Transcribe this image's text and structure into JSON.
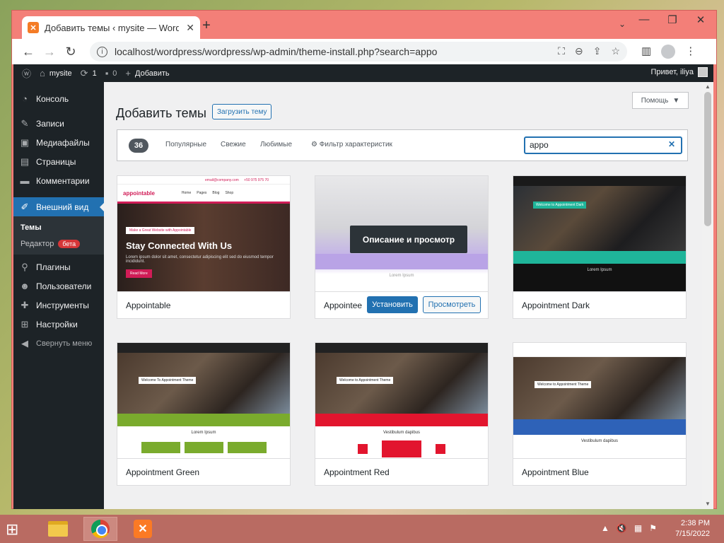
{
  "browser": {
    "tab_title": "Добавить темы ‹ mysite — Word",
    "new_tab_symbol": "+",
    "url": "localhost/wordpress/wordpress/wp-admin/theme-install.php?search=appo"
  },
  "adminbar": {
    "site_name": "mysite",
    "updates_count": "1",
    "comments_count": "0",
    "add_label": "Добавить",
    "greeting": "Привет, iliya"
  },
  "sidebar": {
    "items": [
      {
        "label": "Консоль",
        "icon": "dashboard-icon"
      },
      {
        "label": "Записи",
        "icon": "pin-icon"
      },
      {
        "label": "Медиафайлы",
        "icon": "media-icon"
      },
      {
        "label": "Страницы",
        "icon": "pages-icon"
      },
      {
        "label": "Комментарии",
        "icon": "comments-icon"
      },
      {
        "label": "Внешний вид",
        "icon": "appearance-icon"
      },
      {
        "label": "Плагины",
        "icon": "plugins-icon"
      },
      {
        "label": "Пользователи",
        "icon": "users-icon"
      },
      {
        "label": "Инструменты",
        "icon": "tools-icon"
      },
      {
        "label": "Настройки",
        "icon": "settings-icon"
      }
    ],
    "submenu": {
      "themes": "Темы",
      "editor": "Редактор",
      "editor_badge": "бета"
    },
    "collapse_label": "Свернуть меню"
  },
  "main": {
    "title": "Добавить темы",
    "upload_button": "Загрузить тему",
    "help_button": "Помощь",
    "filter": {
      "count": "36",
      "popular": "Популярные",
      "latest": "Свежие",
      "favorites": "Любимые",
      "feature_filter": "Фильтр характеристик",
      "search_value": "appo"
    },
    "themes": [
      {
        "name": "Appointable"
      },
      {
        "name": "Appointee",
        "overlay": "Описание и просмотр",
        "install": "Установить",
        "preview": "Просмотреть"
      },
      {
        "name": "Appointment Dark"
      },
      {
        "name": "Appointment Green"
      },
      {
        "name": "Appointment Red"
      },
      {
        "name": "Appointment Blue"
      }
    ],
    "shot_text": {
      "appointable_email": "email@company.com",
      "appointable_phone": "+50 975 975 70",
      "appointable_logo": "appointable",
      "appointable_nav": [
        "Home",
        "Pages",
        "Blog",
        "Shop"
      ],
      "appointable_pill": "Make a Great Website with Appointable",
      "appointable_heading": "Stay Connected With Us",
      "appointable_text": "Lorem ipsum dolor sit amet, consectetur adipiscing elit sed do eiusmod tempor incididunt.",
      "appointable_button": "Read More",
      "appointee_shot_text": "Lorem Ipsum",
      "dark_welcome": "Welcome to Appointment Dark",
      "dark_lorem": "Lorem Ipsum",
      "green_welcome": "Welcome To Appointment Theme",
      "green_lorem": "Lorem Ipsum",
      "red_welcome": "Welcome to Appointment Theme",
      "red_lorem": "Vestibulum dapibus",
      "blue_welcome": "Welcome to Appointment Theme",
      "blue_lorem": "Vestibulum dapibus"
    }
  },
  "taskbar": {
    "time": "2:38 PM",
    "date": "7/15/2022"
  },
  "colors": {
    "wp_blue": "#2271b1",
    "admin_dark": "#1d2327",
    "window_frame": "#f37f78",
    "appointable_pink": "#d11c57",
    "dark_teal": "#1fb59a",
    "green_band": "#7aab2d",
    "red_band": "#e2152e",
    "blue_band": "#2e62b8"
  }
}
